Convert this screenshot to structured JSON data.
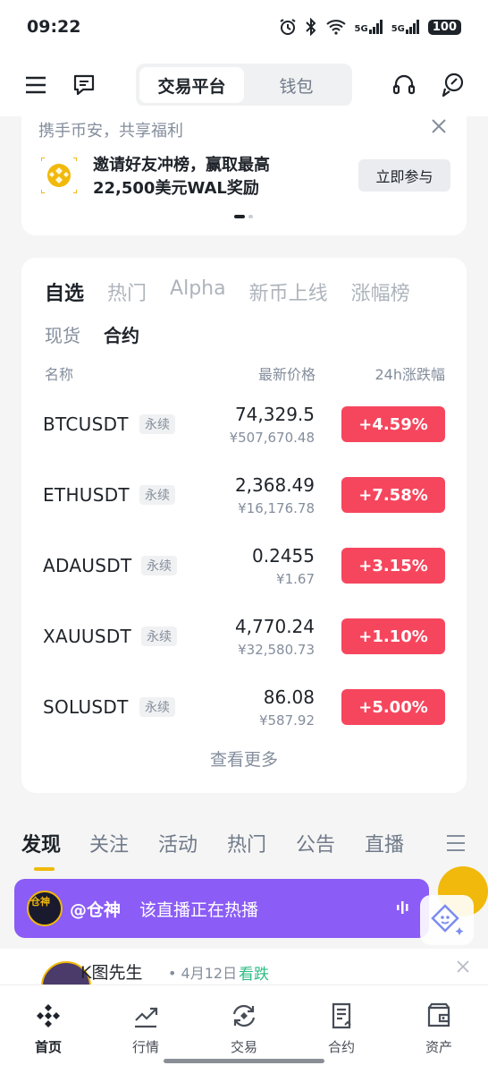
{
  "status_bar": {
    "time": "09:22",
    "icons": [
      "alarm-icon",
      "bluetooth-icon",
      "wifi-icon",
      "signal-5g-icon",
      "signal-5g-icon"
    ],
    "net1": "5G",
    "net2": "5G",
    "battery": "100"
  },
  "top_nav": {
    "tabs": [
      "交易平台",
      "钱包"
    ],
    "active_tab": "交易平台",
    "icons": [
      "menu-icon",
      "message-icon",
      "headset-icon",
      "pen-icon"
    ]
  },
  "banner": {
    "subtitle": "携手币安，共享福利",
    "title_line1": "邀请好友冲榜，赢取最高",
    "title_line2": "22,500美元WAL奖励",
    "cta": "立即参与",
    "page_count": 2,
    "active_page": 1
  },
  "market": {
    "primary_tabs": [
      "自选",
      "热门",
      "Alpha",
      "新币上线",
      "涨幅榜"
    ],
    "secondary_tabs": [
      "现货",
      "合约"
    ],
    "columns": {
      "name": "名称",
      "price": "最新价格",
      "change": "24h涨跌幅"
    },
    "rows": [
      {
        "symbol": "BTCUSDT",
        "tag": "永续",
        "price": "74,329.5",
        "cny": "¥507,670.48",
        "change": "+4.59%"
      },
      {
        "symbol": "ETHUSDT",
        "tag": "永续",
        "price": "2,368.49",
        "cny": "¥16,176.78",
        "change": "+7.58%"
      },
      {
        "symbol": "ADAUSDT",
        "tag": "永续",
        "price": "0.2455",
        "cny": "¥1.67",
        "change": "+3.15%"
      },
      {
        "symbol": "XAUUSDT",
        "tag": "永续",
        "price": "4,770.24",
        "cny": "¥32,580.73",
        "change": "+1.10%"
      },
      {
        "symbol": "SOLUSDT",
        "tag": "永续",
        "price": "86.08",
        "cny": "¥587.92",
        "change": "+5.00%"
      }
    ],
    "more": "查看更多",
    "colors": {
      "up": "#f6465d"
    }
  },
  "discover": {
    "tabs": [
      "发现",
      "关注",
      "活动",
      "热门",
      "公告",
      "直播"
    ],
    "active_tab": "发现",
    "accent": "#f0b90b"
  },
  "live": {
    "avatar_text": "仓神",
    "user": "@仓神",
    "status": "该直播正在热播",
    "color": "#8b5cf6"
  },
  "post": {
    "author": "K图先生",
    "date": "4月12日",
    "tag": "看跌"
  },
  "bottom_nav": {
    "items": [
      {
        "label": "首页",
        "icon": "binance-logo-icon"
      },
      {
        "label": "行情",
        "icon": "chart-icon"
      },
      {
        "label": "交易",
        "icon": "exchange-icon"
      },
      {
        "label": "合约",
        "icon": "contract-icon"
      },
      {
        "label": "资产",
        "icon": "wallet-icon"
      }
    ],
    "active": "首页"
  }
}
